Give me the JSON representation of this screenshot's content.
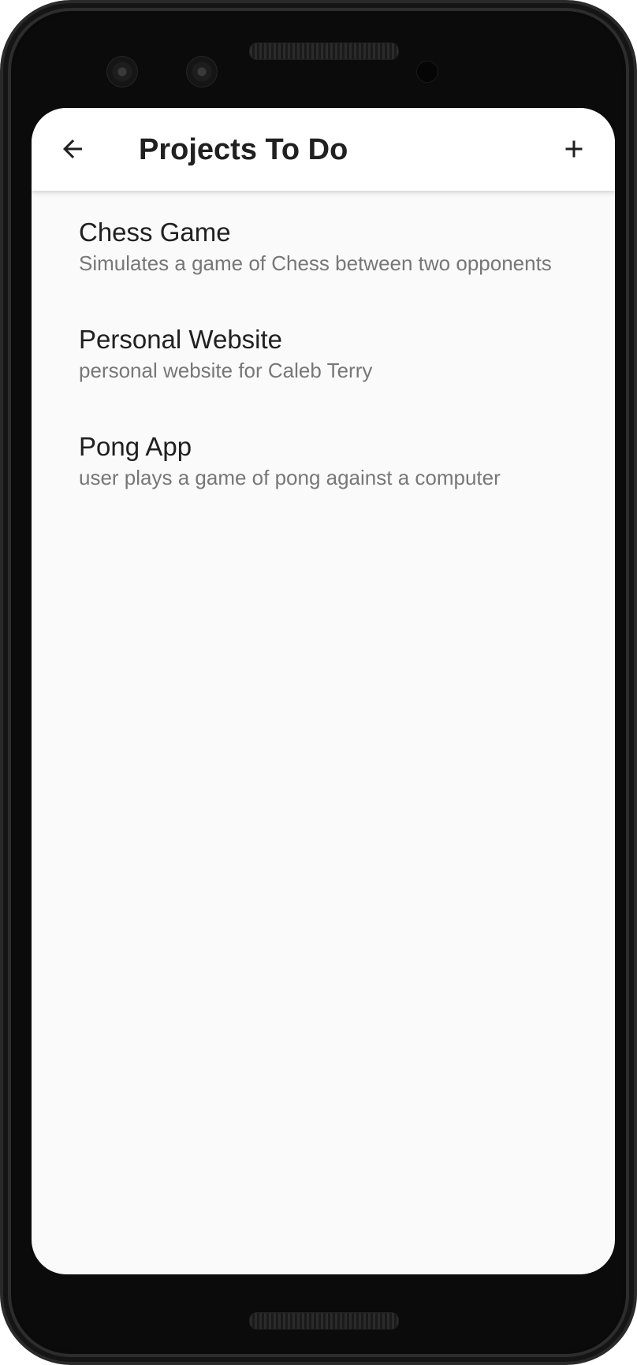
{
  "appbar": {
    "title": "Projects To Do",
    "back_icon": "arrow-back-icon",
    "add_icon": "plus-icon"
  },
  "projects": [
    {
      "title": "Chess Game",
      "subtitle": "Simulates a game of Chess between two opponents"
    },
    {
      "title": "Personal Website",
      "subtitle": "personal website for Caleb Terry"
    },
    {
      "title": "Pong App",
      "subtitle": "user plays a game of pong against a computer"
    }
  ],
  "colors": {
    "background": "#fafafa",
    "appbar": "#ffffff",
    "title_text": "#202020",
    "subtitle_text": "#777777",
    "device_frame": "#0b0b0b"
  }
}
